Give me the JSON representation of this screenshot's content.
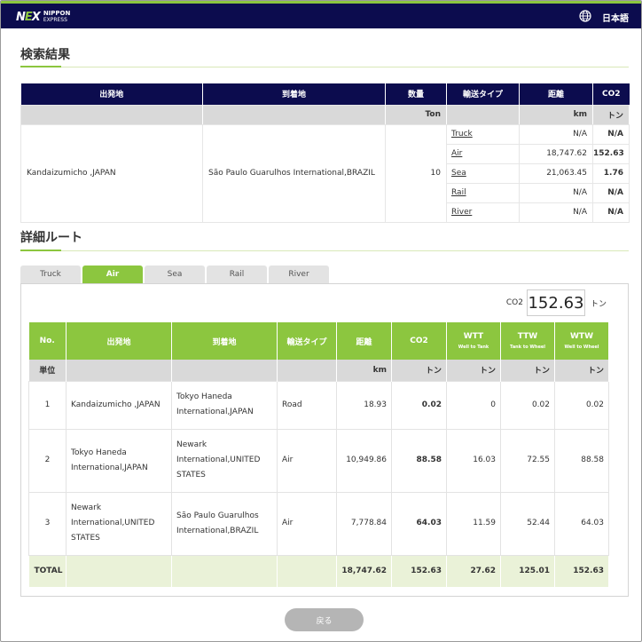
{
  "brand": {
    "mark": "NEX",
    "line1": "NIPPON",
    "line2": "EXPRESS"
  },
  "header": {
    "language": "日本語",
    "globe_icon": "globe-icon"
  },
  "search_results": {
    "title": "検索結果",
    "headers": [
      "出発地",
      "到着地",
      "数量",
      "輸送タイプ",
      "距離",
      "CO2"
    ],
    "units": [
      "",
      "",
      "Ton",
      "",
      "km",
      "トン"
    ],
    "origin": "Kandaizumicho ,JAPAN",
    "destination": "São Paulo Guarulhos International,BRAZIL",
    "quantity": "10",
    "modes": [
      {
        "type": "Truck",
        "distance": "N/A",
        "co2": "N/A"
      },
      {
        "type": "Air",
        "distance": "18,747.62",
        "co2": "152.63"
      },
      {
        "type": "Sea",
        "distance": "21,063.45",
        "co2": "1.76"
      },
      {
        "type": "Rail",
        "distance": "N/A",
        "co2": "N/A"
      },
      {
        "type": "River",
        "distance": "N/A",
        "co2": "N/A"
      }
    ]
  },
  "detail": {
    "title": "詳細ルート",
    "tabs": [
      "Truck",
      "Air",
      "Sea",
      "Rail",
      "River"
    ],
    "active_tab": "Air",
    "co2_label": "CO2",
    "co2_value": "152.63",
    "co2_unit": "トン",
    "headers": [
      "No.",
      "出発地",
      "到着地",
      "輸送タイプ",
      "距離",
      "CO2",
      "WTT",
      "TTW",
      "WTW"
    ],
    "subheaders": {
      "wtt": "Well to Tank",
      "ttw": "Tank to Wheel",
      "wtw": "Well to Wheel"
    },
    "units": [
      "単位",
      "",
      "",
      "",
      "km",
      "トン",
      "トン",
      "トン",
      "トン"
    ],
    "rows": [
      {
        "no": "1",
        "origin": "Kandaizumicho ,JAPAN",
        "destination": "Tokyo Haneda International,JAPAN",
        "mode": "Road",
        "distance": "18.93",
        "co2": "0.02",
        "wtt": "0",
        "ttw": "0.02",
        "wtw": "0.02"
      },
      {
        "no": "2",
        "origin": "Tokyo Haneda International,JAPAN",
        "destination": "Newark International,UNITED STATES",
        "mode": "Air",
        "distance": "10,949.86",
        "co2": "88.58",
        "wtt": "16.03",
        "ttw": "72.55",
        "wtw": "88.58"
      },
      {
        "no": "3",
        "origin": "Newark International,UNITED STATES",
        "destination": "São Paulo Guarulhos International,BRAZIL",
        "mode": "Air",
        "distance": "7,778.84",
        "co2": "64.03",
        "wtt": "11.59",
        "ttw": "52.44",
        "wtw": "64.03"
      }
    ],
    "total": {
      "label": "TOTAL",
      "distance": "18,747.62",
      "co2": "152.63",
      "wtt": "27.62",
      "ttw": "125.01",
      "wtw": "152.63"
    }
  },
  "back_button": "戻る",
  "colors": {
    "navy": "#0c0c4e",
    "green": "#8cc63f"
  }
}
